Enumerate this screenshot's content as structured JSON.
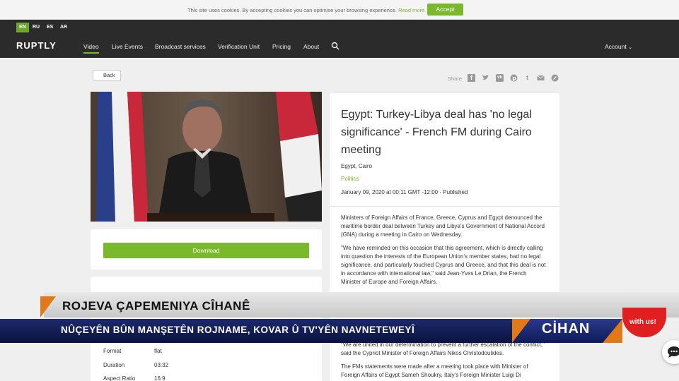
{
  "cookie": {
    "text": "This site uses cookies. By accepting cookies you can optimise your browsing experience.",
    "more": "Read more.",
    "accept": "Accept"
  },
  "nav": {
    "languages": [
      "EN",
      "RU",
      "ES",
      "AR"
    ],
    "logo": "RUPTLY",
    "items": [
      "Video",
      "Live Events",
      "Broadcast services",
      "Verification Unit",
      "Pricing",
      "About"
    ],
    "account": "Account"
  },
  "page": {
    "back": "Back",
    "share": "Share",
    "download": "Download"
  },
  "meta": {
    "rows": [
      {
        "label": "Format",
        "value": "flat"
      },
      {
        "label": "Duration",
        "value": "03:32"
      },
      {
        "label": "Aspect Ratio",
        "value": "16:9"
      }
    ]
  },
  "article": {
    "title": "Egypt: Turkey-Libya deal has 'no legal significance' - French FM during Cairo meeting",
    "location": "Egypt, Cairo",
    "category": "Politics",
    "date": "January 09, 2020 at 00:11 GMT -12:00 · Published",
    "p1": "Ministers of Foreign Affairs of France, Greece, Cyprus and Egypt denounced the maritime border deal between Turkey and Libya's Government of National Accord (GNA) during a meeting in Cairo on Wednesday.",
    "p2": "\"We have reminded on this occasion that this agreement, which is directly calling into question the interests of the European Union's member states, had no legal significance, and particularly touched Cyprus and Greece, and that this deal is not in accordance with international law,\" said Jean-Yves Le Drian, the French Minister of Europe and Foreign Affairs.",
    "p3": "\"We are united in our determination to prevent a further escalation of the conflict,\" said the Cypriot Minister of Foreign Affairs Nikos Christodoulides.",
    "p4": "The FMs statements were made after a meeting took place with Minister of Foreign Affairs of Egypt Sameh Shoukry, Italy's Foreign Minister Luigi Di"
  },
  "overlay": {
    "line1": "ROJEVA ÇAPEMENIYA CÎHANÊ",
    "line2": "NÛÇEYÊN BÛN MANŞETÊN ROJNAME, KOVAR Û TV'YÊN NAVNETEWEYÎ",
    "brand": "CİHAN"
  },
  "chat": {
    "label": "with us!"
  },
  "colors": {
    "accent": "#7ab82c",
    "nav_bg": "#2b2b2b",
    "overlay_blue": "#1d2a6b",
    "overlay_orange": "#e07a18"
  }
}
